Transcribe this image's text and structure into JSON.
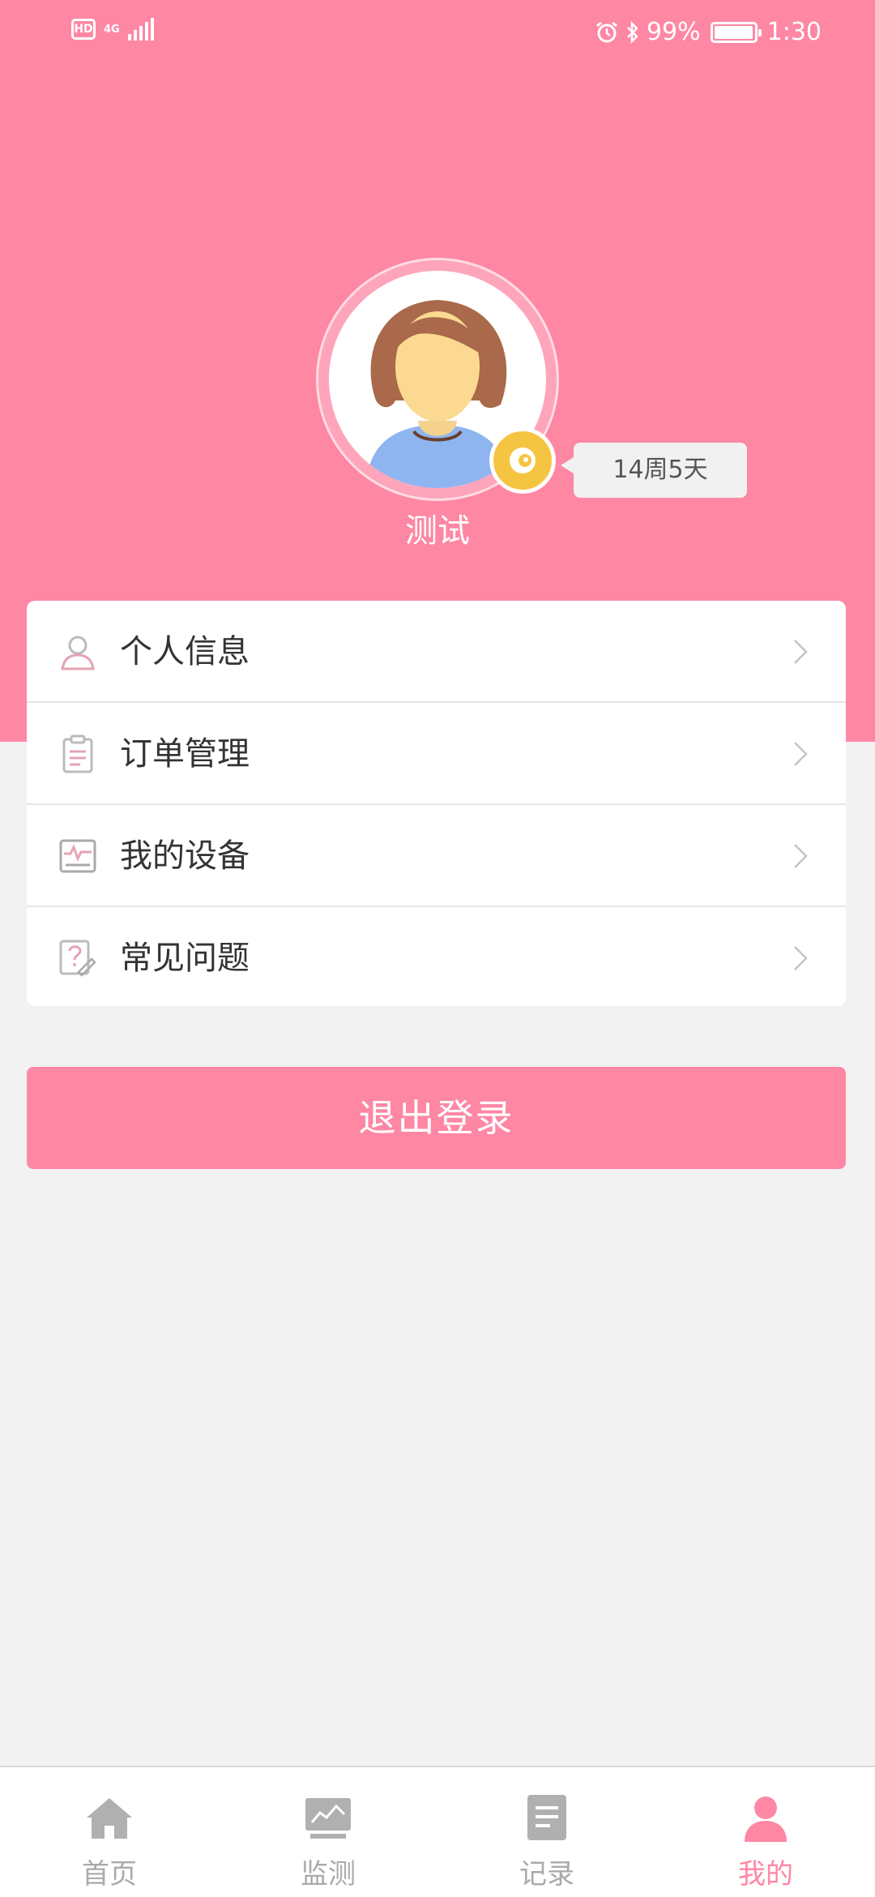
{
  "status_bar": {
    "left_badge": "HD",
    "network": "4G",
    "battery_percent": "99%",
    "battery_level": 0.99,
    "time": "1:30",
    "icons": [
      "alarm-icon",
      "bluetooth-icon",
      "battery-icon"
    ]
  },
  "profile": {
    "name": "测试",
    "pregnancy_week": "14周5天",
    "badge_icon": "level-badge-icon"
  },
  "menu": {
    "items": [
      {
        "label": "个人信息",
        "icon": "person-icon"
      },
      {
        "label": "订单管理",
        "icon": "clipboard-icon"
      },
      {
        "label": "我的设备",
        "icon": "monitor-icon"
      },
      {
        "label": "常见问题",
        "icon": "question-icon"
      }
    ]
  },
  "logout_label": "退出登录",
  "bottom_nav": {
    "items": [
      {
        "label": "首页",
        "icon": "home-icon",
        "active": false
      },
      {
        "label": "监测",
        "icon": "chart-icon",
        "active": false
      },
      {
        "label": "记录",
        "icon": "document-icon",
        "active": false
      },
      {
        "label": "我的",
        "icon": "user-icon",
        "active": true
      }
    ]
  },
  "colors": {
    "brand_pink": "#fe87a4",
    "background": "#f2f2f2",
    "badge_yellow": "#f5c542",
    "inactive_nav": "#aaaaaa"
  }
}
